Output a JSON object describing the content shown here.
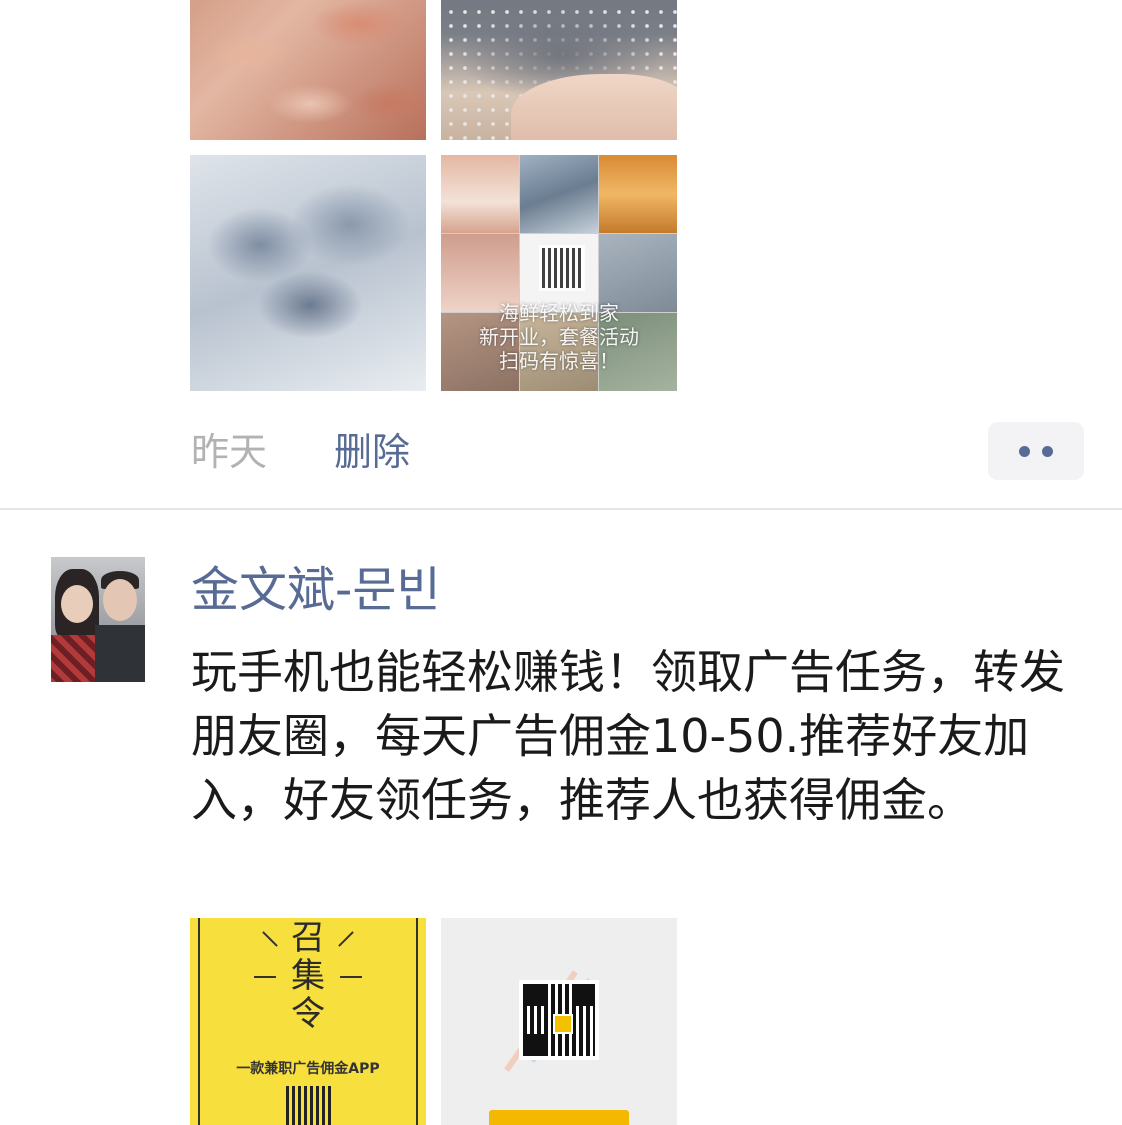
{
  "post1": {
    "collage_text": [
      "海鲜轻松到家",
      "新开业，套餐活动",
      "扫码有惊喜！"
    ],
    "time": "昨天",
    "delete_label": "删除"
  },
  "post2": {
    "username": "金文斌-문빈",
    "text": "玩手机也能轻松赚钱！领取广告任务，转发朋友圈，每天广告佣金10-50.推荐好友加入，好友领任务，推荐人也获得佣金。",
    "poster": {
      "title_lines": [
        "召",
        "集",
        "令"
      ],
      "subtitle": "一款兼职广告佣金APP"
    }
  },
  "colors": {
    "link_blue": "#576b95",
    "time_gray": "#b2b2b2",
    "divider": "#e5e5e5"
  }
}
